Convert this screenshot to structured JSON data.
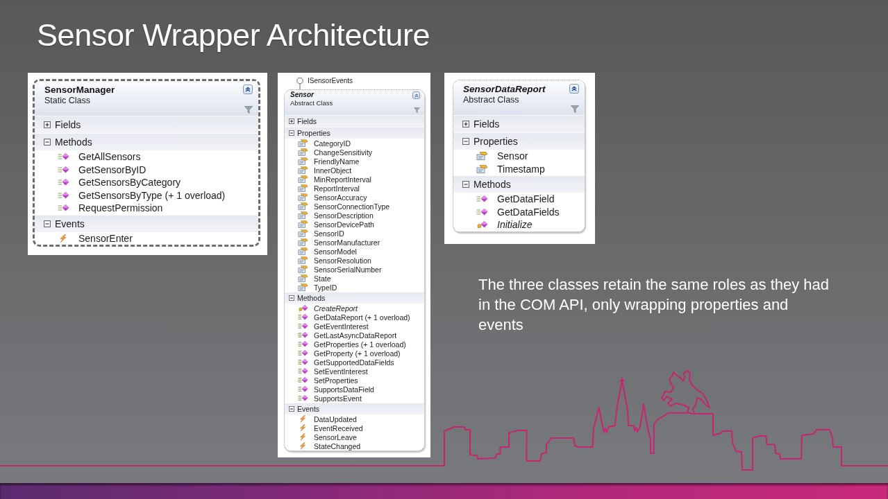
{
  "slide": {
    "title": "Sensor Wrapper Architecture"
  },
  "classes": [
    {
      "name": "SensorManager",
      "kind": "static",
      "subtitle": "Static Class",
      "sections": [
        {
          "title": "Fields",
          "expanded": false
        },
        {
          "title": "Methods",
          "expanded": true,
          "members": [
            {
              "name": "GetAllSensors",
              "kind": "method"
            },
            {
              "name": "GetSensorByID",
              "kind": "method"
            },
            {
              "name": "GetSensorsByCategory",
              "kind": "method"
            },
            {
              "name": "GetSensorsByType (+ 1 overload)",
              "kind": "method"
            },
            {
              "name": "RequestPermission",
              "kind": "method"
            }
          ]
        },
        {
          "title": "Events",
          "expanded": true,
          "members": [
            {
              "name": "SensorEnter",
              "kind": "event"
            }
          ]
        }
      ]
    },
    {
      "name": "Sensor",
      "kind": "abstract",
      "subtitle": "Abstract Class",
      "interfaces": [
        "ISensorEvents"
      ],
      "sections": [
        {
          "title": "Fields",
          "expanded": false
        },
        {
          "title": "Properties",
          "expanded": true,
          "members": [
            {
              "name": "CategoryID",
              "kind": "property"
            },
            {
              "name": "ChangeSensitivity",
              "kind": "property"
            },
            {
              "name": "FriendlyName",
              "kind": "property"
            },
            {
              "name": "InnerObject",
              "kind": "property"
            },
            {
              "name": "MinReportInterval",
              "kind": "property"
            },
            {
              "name": "ReportInterval",
              "kind": "property"
            },
            {
              "name": "SensorAccuracy",
              "kind": "property"
            },
            {
              "name": "SensorConnectionType",
              "kind": "property"
            },
            {
              "name": "SensorDescription",
              "kind": "property"
            },
            {
              "name": "SensorDevicePath",
              "kind": "property"
            },
            {
              "name": "SensorID",
              "kind": "property"
            },
            {
              "name": "SensorManufacturer",
              "kind": "property"
            },
            {
              "name": "SensorModel",
              "kind": "property"
            },
            {
              "name": "SensorResolution",
              "kind": "property"
            },
            {
              "name": "SensorSerialNumber",
              "kind": "property"
            },
            {
              "name": "State",
              "kind": "property"
            },
            {
              "name": "TypeID",
              "kind": "property"
            }
          ]
        },
        {
          "title": "Methods",
          "expanded": true,
          "members": [
            {
              "name": "CreateReport",
              "kind": "abstract_method"
            },
            {
              "name": "GetDataReport (+ 1 overload)",
              "kind": "method"
            },
            {
              "name": "GetEventInterest",
              "kind": "method"
            },
            {
              "name": "GetLastAsyncDataReport",
              "kind": "method"
            },
            {
              "name": "GetProperties (+ 1 overload)",
              "kind": "method"
            },
            {
              "name": "GetProperty (+ 1 overload)",
              "kind": "method"
            },
            {
              "name": "GetSupportedDataFields",
              "kind": "method"
            },
            {
              "name": "SetEventInterest",
              "kind": "method"
            },
            {
              "name": "SetProperties",
              "kind": "method"
            },
            {
              "name": "SupportsDataField",
              "kind": "method"
            },
            {
              "name": "SupportsEvent",
              "kind": "method"
            }
          ]
        },
        {
          "title": "Events",
          "expanded": true,
          "members": [
            {
              "name": "DataUpdated",
              "kind": "event"
            },
            {
              "name": "EventReceived",
              "kind": "event"
            },
            {
              "name": "SensorLeave",
              "kind": "event"
            },
            {
              "name": "StateChanged",
              "kind": "event"
            }
          ]
        }
      ]
    },
    {
      "name": "SensorDataReport",
      "kind": "abstract",
      "subtitle": "Abstract Class",
      "sections": [
        {
          "title": "Fields",
          "expanded": false
        },
        {
          "title": "Properties",
          "expanded": true,
          "members": [
            {
              "name": "Sensor",
              "kind": "property"
            },
            {
              "name": "Timestamp",
              "kind": "property"
            }
          ]
        },
        {
          "title": "Methods",
          "expanded": true,
          "members": [
            {
              "name": "GetDataField",
              "kind": "method"
            },
            {
              "name": "GetDataFields",
              "kind": "method"
            },
            {
              "name": "Initialize",
              "kind": "abstract_method"
            }
          ]
        }
      ]
    }
  ],
  "caption": "The three classes retain the same roles as they had in the COM API, only wrapping properties and events"
}
